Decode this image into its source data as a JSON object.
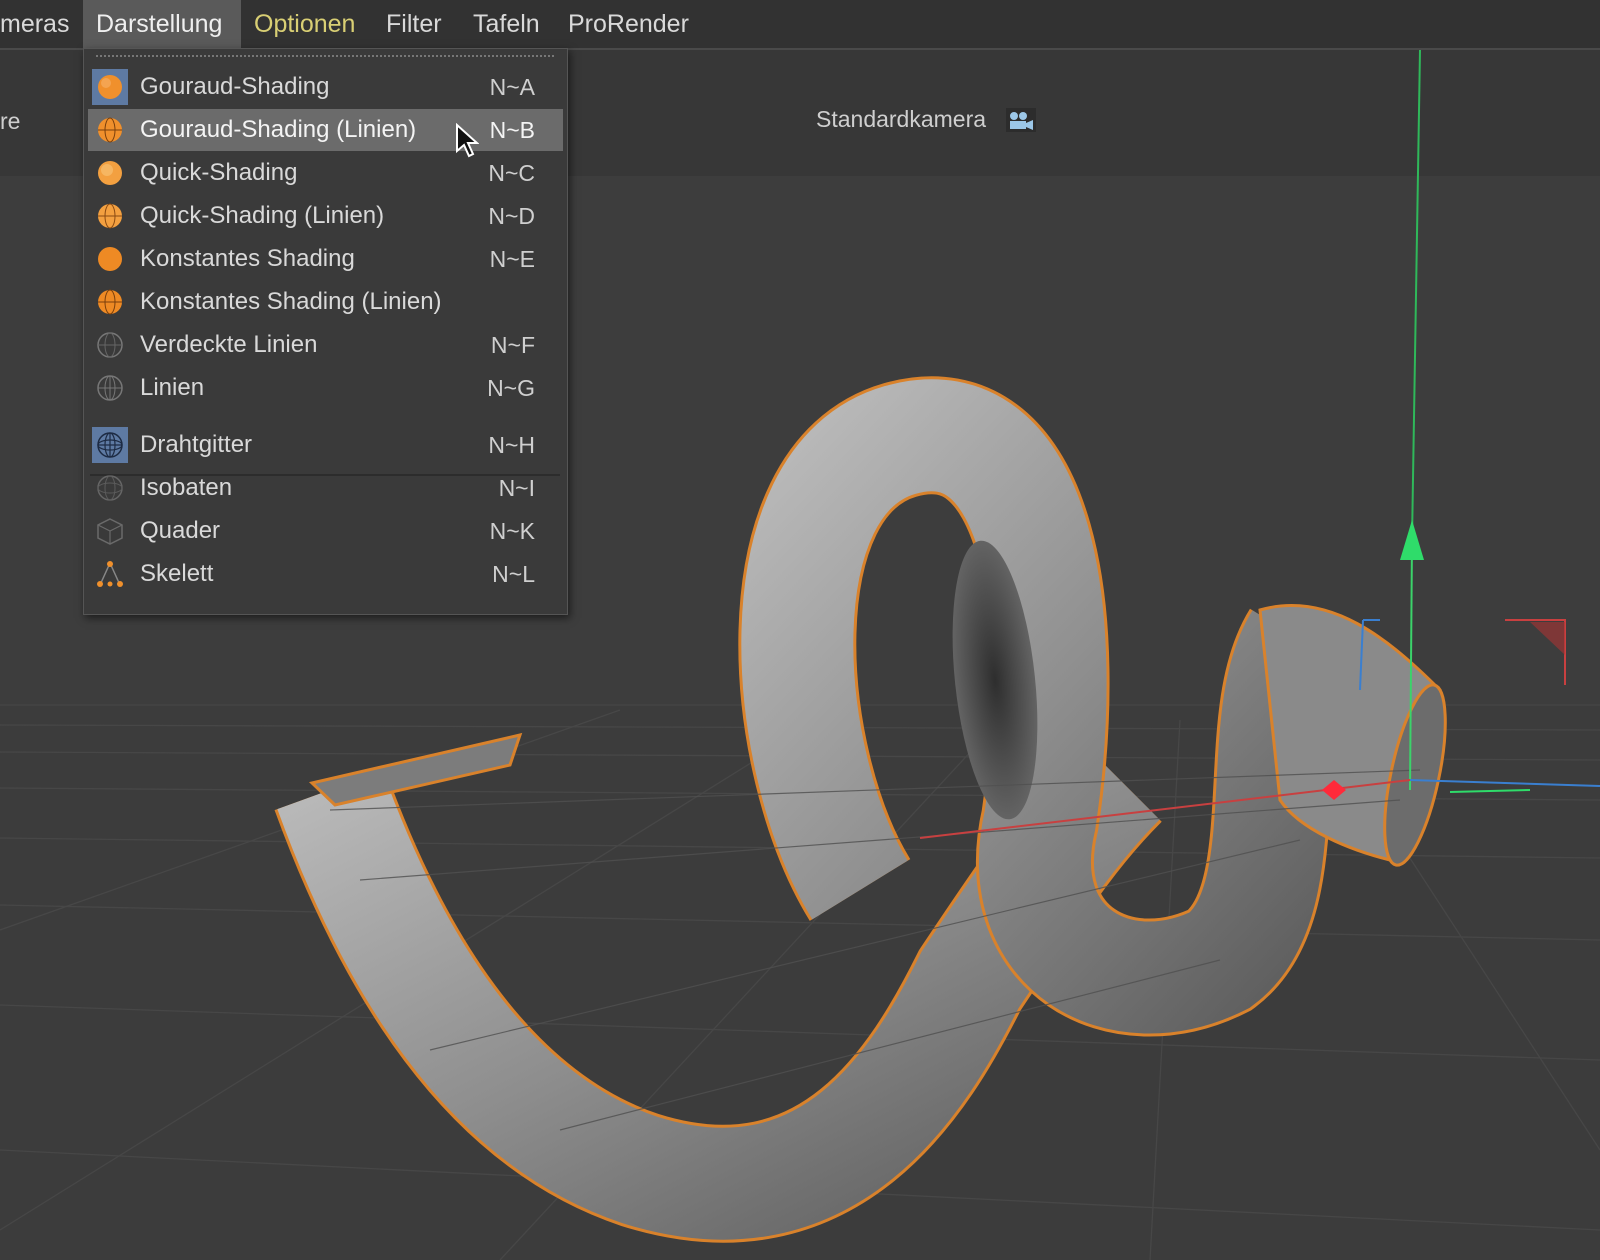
{
  "menubar": {
    "items": [
      {
        "label": "meras",
        "state": "normal"
      },
      {
        "label": "Darstellung",
        "state": "active"
      },
      {
        "label": "Optionen",
        "state": "highlight"
      },
      {
        "label": "Filter",
        "state": "normal"
      },
      {
        "label": "Tafeln",
        "state": "normal"
      },
      {
        "label": "ProRender",
        "state": "normal"
      }
    ]
  },
  "viewport": {
    "camera_label": "Standardkamera",
    "camera_icon": "camera-icon",
    "left_clipped_label": "re"
  },
  "dropdown": {
    "items": [
      {
        "label": "Gouraud-Shading",
        "shortcut": "N~A",
        "icon": "sphere-shaded-icon",
        "selected": true
      },
      {
        "label": "Gouraud-Shading (Linien)",
        "shortcut": "N~B",
        "icon": "sphere-shaded-lines-icon",
        "hover": true
      },
      {
        "label": "Quick-Shading",
        "shortcut": "N~C",
        "icon": "sphere-quick-icon"
      },
      {
        "label": "Quick-Shading (Linien)",
        "shortcut": "N~D",
        "icon": "sphere-quick-lines-icon"
      },
      {
        "label": "Konstantes Shading",
        "shortcut": "N~E",
        "icon": "sphere-constant-icon"
      },
      {
        "label": "Konstantes Shading (Linien)",
        "shortcut": "",
        "icon": "sphere-constant-lines-icon"
      },
      {
        "label": "Verdeckte Linien",
        "shortcut": "N~F",
        "icon": "hidden-lines-icon"
      },
      {
        "label": "Linien",
        "shortcut": "N~G",
        "icon": "lines-icon"
      },
      {
        "label": "Drahtgitter",
        "shortcut": "N~H",
        "icon": "wireframe-icon",
        "selected": true
      },
      {
        "label": "Isobaten",
        "shortcut": "N~I",
        "icon": "isoparms-icon"
      },
      {
        "label": "Quader",
        "shortcut": "N~K",
        "icon": "box-icon"
      },
      {
        "label": "Skelett",
        "shortcut": "N~L",
        "icon": "skeleton-icon"
      }
    ]
  },
  "colors": {
    "accent_orange": "#f0902c",
    "selection_outline": "#d9822b",
    "menu_active_bg": "#5a5a5a",
    "highlight_text": "#d9cf74"
  }
}
